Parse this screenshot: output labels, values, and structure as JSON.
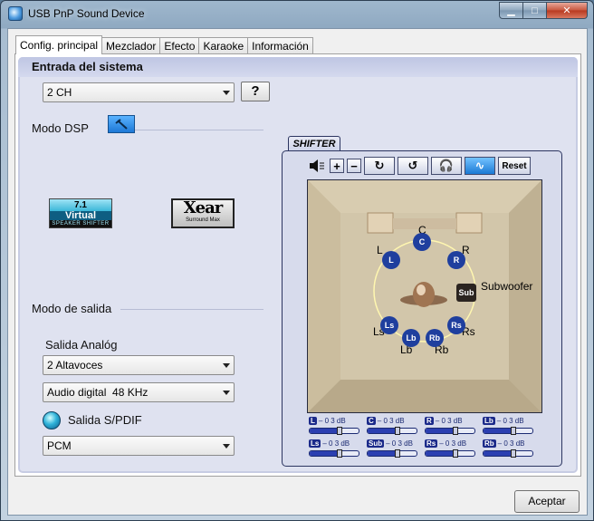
{
  "window": {
    "title": "USB PnP Sound Device"
  },
  "tabs": [
    {
      "label": "Config. principal",
      "active": true
    },
    {
      "label": "Mezclador",
      "active": false
    },
    {
      "label": "Efecto",
      "active": false
    },
    {
      "label": "Karaoke",
      "active": false
    },
    {
      "label": "Información",
      "active": false
    }
  ],
  "system_input": {
    "heading": "Entrada del sistema",
    "channel_value": "2 CH",
    "help_label": "?"
  },
  "dsp": {
    "label": "Modo DSP",
    "virtual_badge": {
      "top": "7.1",
      "mid": "Virtual",
      "bottom": "SPEAKER SHIFTER"
    },
    "xear_badge": {
      "title": "Xear",
      "sub": "Surround Max"
    }
  },
  "output": {
    "heading": "Modo de salida",
    "analog_label": "Salida Analóg",
    "speakers_value": "2 Altavoces",
    "digital_value": "Audio digital  48 KHz",
    "spdif_label": "Salida S/PDIF",
    "spdif_value": "PCM"
  },
  "shifter": {
    "tab_label": "SHIFTER",
    "reset_label": "Reset",
    "plus_label": "+",
    "minus_label": "−",
    "speakers": {
      "c": "C",
      "l": "L",
      "r": "R",
      "sub": "Subwoofer",
      "ls": "Ls",
      "lb": "Lb",
      "rb": "Rb",
      "rs": "Rs",
      "badge_c": "C",
      "badge_l": "L",
      "badge_r": "R",
      "badge_sub": "Sub",
      "badge_ls": "Ls",
      "badge_lb": "Lb",
      "badge_rb": "Rb",
      "badge_rs": "Rs"
    },
    "volumes": [
      {
        "ch": "L",
        "text": "– 0 3 dB",
        "level": 0.6
      },
      {
        "ch": "C",
        "text": "– 0 3 dB",
        "level": 0.6
      },
      {
        "ch": "R",
        "text": "– 0 3 dB",
        "level": 0.6
      },
      {
        "ch": "Lb",
        "text": "– 0 3 dB",
        "level": 0.6
      },
      {
        "ch": "Ls",
        "text": "– 0 3 dB",
        "level": 0.6
      },
      {
        "ch": "Sub",
        "text": "– 0 3 dB",
        "level": 0.6
      },
      {
        "ch": "Rs",
        "text": "– 0 3 dB",
        "level": 0.6
      },
      {
        "ch": "Rb",
        "text": "– 0 3 dB",
        "level": 0.6
      }
    ]
  },
  "footer": {
    "accept_label": "Aceptar"
  },
  "colors": {
    "accent": "#1d78d6",
    "panel": "#dfe2f0",
    "shifter_border": "#2c3560"
  }
}
